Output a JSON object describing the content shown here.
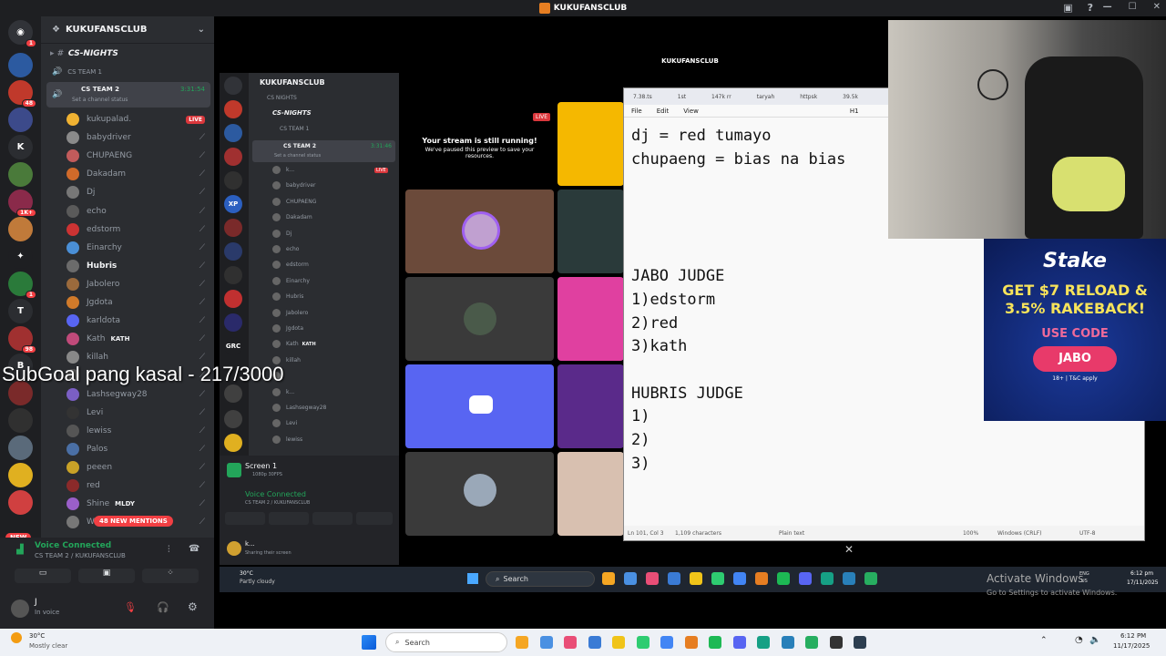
{
  "window": {
    "title": "KUKUFANSCLUB"
  },
  "server": {
    "name": "KUKUFANSCLUB"
  },
  "channels": {
    "cs_nights": "CS-NIGHTS",
    "cs_team1": "CS TEAM 1",
    "cs_team2": "CS TEAM 2",
    "timer": "3:31:54",
    "status_prompt": "Set a channel status"
  },
  "members": [
    {
      "name": "kukupalad.",
      "live": "LIVE",
      "color": "#f0b232"
    },
    {
      "name": "babydriver",
      "color": "#8a8a8a"
    },
    {
      "name": "CHUPAENG",
      "color": "#c25b5b"
    },
    {
      "name": "Dakadam",
      "color": "#d06a2a"
    },
    {
      "name": "Dj",
      "color": "#777"
    },
    {
      "name": "echo",
      "color": "#5a5a5a"
    },
    {
      "name": "edstorm",
      "color": "#c33"
    },
    {
      "name": "Einarchy",
      "color": "#4a8fd6"
    },
    {
      "name": "Hubris",
      "color": "#6b6b6b",
      "bold": true
    },
    {
      "name": "Jabolero",
      "color": "#9b6a3c"
    },
    {
      "name": "Jgdota",
      "color": "#d07a2a"
    },
    {
      "name": "karldota",
      "color": "#5865f2"
    },
    {
      "name": "Kath",
      "tag": "KATH",
      "color": "#c04a7a"
    },
    {
      "name": "killah",
      "color": "#888"
    },
    {
      "name": "",
      "color": "#555"
    },
    {
      "name": "Lashsegway28",
      "color": "#7b5fc4"
    },
    {
      "name": "Levi",
      "color": "#333"
    },
    {
      "name": "lewiss",
      "color": "#555"
    },
    {
      "name": "Palos",
      "color": "#4a6fa5"
    },
    {
      "name": "peeen",
      "color": "#c9a227"
    },
    {
      "name": "red",
      "color": "#8b2a2a"
    },
    {
      "name": "Shine",
      "tag": "MLDY",
      "color": "#9a5fc9"
    },
    {
      "name": "W",
      "color": "#777"
    }
  ],
  "new_mentions": "48 NEW MENTIONS",
  "new_badge": "NEW",
  "voice": {
    "title": "Voice Connected",
    "channel": "CS TEAM 2 / KUKUFANSCLUB"
  },
  "user": {
    "name": "J",
    "status": "In voice"
  },
  "overlay_text": "SubGoal pang kasal - 217/3000",
  "inner": {
    "server": "KUKUFANSCLUB",
    "cs_nights": "CS NIGHTS",
    "cs_nights2": "CS-NIGHTS",
    "cs_team1": "CS TEAM 1",
    "cs_team2": "CS TEAM 2",
    "timer": "3:31:46",
    "status_prompt": "Set a channel status",
    "members": [
      "k...",
      "babydriver",
      "CHUPAENG",
      "Dakadam",
      "Dj",
      "echo",
      "edstorm",
      "Einarchy",
      "Hubris",
      "Jabolero",
      "Jgdota",
      "Kath",
      "killah",
      "",
      "k...",
      "Lashsegway28",
      "Levi",
      "lewiss"
    ],
    "kath_tag": "KATH",
    "live": "LIVE",
    "screen_title": "Screen 1",
    "screen_sub": "1080p 30FPS",
    "voice_title": "Voice Connected",
    "voice_channel": "CS TEAM 2 / KUKUFANSCLUB",
    "user_name": "k...",
    "user_status": "Sharing their screen",
    "window_title": "KUKUFANSCLUB",
    "paused_title": "Your stream is still running!",
    "paused_sub": "We've paused this preview to save your resources.",
    "live_tag": "LIVE"
  },
  "notepad": {
    "tabs": [
      "7.38.ts",
      "1st",
      "147k rr",
      "taryah",
      "httpsk",
      "39.5k"
    ],
    "menu": [
      "File",
      "Edit",
      "View"
    ],
    "heading": "H1",
    "content": "dj = red tumayo\nchupaeng = bias na bias\n\n\n\n\nJABO JUDGE\n1)edstorm\n2)red\n3)kath\n\nHUBRIS JUDGE\n1)\n2)\n3)",
    "status": {
      "pos": "Ln 101, Col 3",
      "chars": "1,109 characters",
      "format": "Plain text",
      "zoom": "100%",
      "eol": "Windows (CRLF)",
      "enc": "UTF-8"
    }
  },
  "ad": {
    "brand": "Stake",
    "headline": "GET $7 RELOAD & 3.5% RAKEBACK!",
    "use_code": "USE CODE",
    "code": "JABO",
    "fine": "18+ | T&C apply"
  },
  "taskbar_inner": {
    "temp": "30°C",
    "weather": "Partly cloudy",
    "search": "Search",
    "activate_title": "Activate Windows",
    "activate_sub": "Go to Settings to activate Windows.",
    "lang": "ENG",
    "lang2": "US",
    "time": "6:12 pm",
    "date": "17/11/2025"
  },
  "taskbar": {
    "temp": "30°C",
    "weather": "Mostly clear",
    "search": "Search",
    "time": "6:12 PM",
    "date": "11/17/2025"
  }
}
